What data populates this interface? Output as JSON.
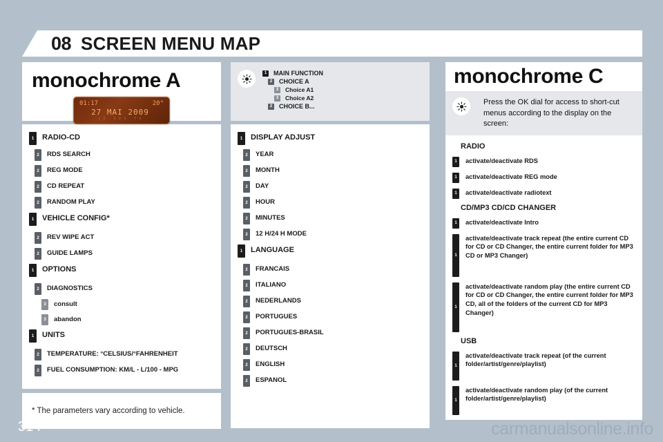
{
  "header": {
    "chapter_number": "08",
    "title": "SCREEN MENU MAP"
  },
  "page_number": "314",
  "watermark": "carmanualsonline.info",
  "left_column": {
    "title": "monochrome A",
    "display_graphic": {
      "time": "01:17",
      "temperature": "20°",
      "date": "27 MAI 2009",
      "indicators": "LD   RDS   TA"
    },
    "menu": [
      {
        "level": 1,
        "label": "RADIO-CD"
      },
      {
        "level": 2,
        "label": "RDS SEARCH"
      },
      {
        "level": 2,
        "label": "REG MODE"
      },
      {
        "level": 2,
        "label": "CD REPEAT"
      },
      {
        "level": 2,
        "label": "RANDOM PLAY"
      },
      {
        "level": 1,
        "label": "VEHICLE CONFIG*"
      },
      {
        "level": 2,
        "label": "REV WIPE ACT"
      },
      {
        "level": 2,
        "label": "GUIDE LAMPS"
      },
      {
        "level": 1,
        "label": "OPTIONS"
      },
      {
        "level": 2,
        "label": "DIAGNOSTICS"
      },
      {
        "level": 3,
        "label": "consult"
      },
      {
        "level": 3,
        "label": "abandon"
      },
      {
        "level": 1,
        "label": "UNITS"
      },
      {
        "level": 2,
        "label": "TEMPERATURE: °CELSIUS/°FAHRENHEIT"
      },
      {
        "level": 2,
        "label": "FUEL CONSUMPTION: KM/L - L/100 - MPG"
      }
    ],
    "footnote": "* The parameters vary according to vehicle."
  },
  "legend": {
    "icon": "bulb-icon",
    "items": [
      {
        "level": 1,
        "label": "MAIN FUNCTION"
      },
      {
        "level": 2,
        "label": "CHOICE A"
      },
      {
        "level": 3,
        "label": "Choice A1"
      },
      {
        "level": 3,
        "label": "Choice A2"
      },
      {
        "level": 2,
        "label": "CHOICE B..."
      }
    ]
  },
  "mid_column": {
    "menu": [
      {
        "level": 1,
        "label": "DISPLAY ADJUST"
      },
      {
        "level": 2,
        "label": "YEAR"
      },
      {
        "level": 2,
        "label": "MONTH"
      },
      {
        "level": 2,
        "label": "DAY"
      },
      {
        "level": 2,
        "label": "HOUR"
      },
      {
        "level": 2,
        "label": "MINUTES"
      },
      {
        "level": 2,
        "label": "12 H/24 H MODE"
      },
      {
        "level": 1,
        "label": "LANGUAGE"
      },
      {
        "level": 2,
        "label": "FRANCAIS"
      },
      {
        "level": 2,
        "label": "ITALIANO"
      },
      {
        "level": 2,
        "label": "NEDERLANDS"
      },
      {
        "level": 2,
        "label": "PORTUGUES"
      },
      {
        "level": 2,
        "label": "PORTUGUES-BRASIL"
      },
      {
        "level": 2,
        "label": "DEUTSCH"
      },
      {
        "level": 2,
        "label": "ENGLISH"
      },
      {
        "level": 2,
        "label": "ESPANOL"
      }
    ]
  },
  "right_column": {
    "title": "monochrome C",
    "note_icon": "bulb-icon",
    "note": "Press the OK dial for access to short-cut menus according to the display on the screen:",
    "sections": [
      {
        "heading": "RADIO",
        "items": [
          {
            "marker": "1",
            "size": "h1",
            "label": "activate/deactivate RDS"
          },
          {
            "marker": "1",
            "size": "h1",
            "label": "activate/deactivate REG mode"
          },
          {
            "marker": "1",
            "size": "h1",
            "label": "activate/deactivate radiotext"
          }
        ]
      },
      {
        "heading": "CD/MP3 CD/CD CHANGER",
        "items": [
          {
            "marker": "1",
            "size": "h1",
            "label": "activate/deactivate Intro"
          },
          {
            "marker": "1",
            "size": "h3",
            "label": "activate/deactivate track repeat (the entire current CD for CD or CD Changer, the entire current folder for MP3 CD or MP3 Changer)"
          },
          {
            "marker": "1",
            "size": "h4",
            "label": "activate/deactivate random play (the entire current CD for CD or CD Changer, the entire current folder for MP3 CD, all of the folders of the current CD for MP3 Changer)"
          }
        ]
      },
      {
        "heading": "USB",
        "items": [
          {
            "marker": "1",
            "size": "h2",
            "label": "activate/deactivate track repeat (of the current folder/artist/genre/playlist)"
          },
          {
            "marker": "1",
            "size": "h2",
            "label": "activate/deactivate random play (of the current folder/artist/genre/playlist)"
          }
        ]
      }
    ]
  },
  "colors": {
    "page_background": "#b3c0cc",
    "panel_background": "#ffffff",
    "legend_background": "#e5e7ea",
    "marker_level1": "#1c1c1c",
    "marker_level2": "#5a5f66",
    "marker_level3": "#8b9097",
    "display_amber": "#f0a060"
  }
}
